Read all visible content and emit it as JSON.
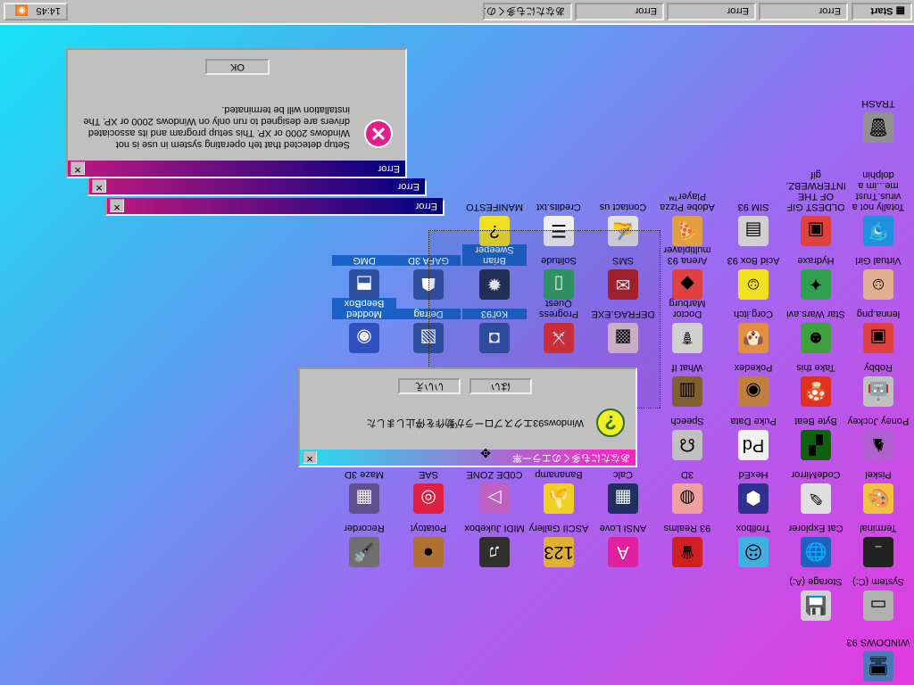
{
  "taskbar": {
    "start_label": "Start",
    "tasks": [
      "Error",
      "Error",
      "Error",
      "あなたにも多くのエ..."
    ],
    "clock": "14:45"
  },
  "desktop_icons": {
    "col1": [
      {
        "label": "WINDOWS 93",
        "icon": "computer-icon",
        "color": "#4a7ab5"
      },
      {
        "label": "System (C:)",
        "icon": "drive-icon",
        "color": "#b0b0b0"
      },
      {
        "label": "Terminal",
        "icon": "terminal-icon",
        "color": "#222222"
      },
      {
        "label": "Piskel",
        "icon": "palette-icon",
        "color": "#f0c040"
      },
      {
        "label": "Poney Jockey",
        "icon": "pony-icon",
        "color": "#b060d0"
      },
      {
        "label": "Robby",
        "icon": "robot-icon",
        "color": "#c0c0c0"
      },
      {
        "label": "lenna.png",
        "icon": "image-icon",
        "color": "#e04040"
      },
      {
        "label": "Virtual Girl",
        "icon": "girl-icon",
        "color": "#e0b090"
      },
      {
        "label": "Totally not a virus.Trust me...im a dolphin",
        "icon": "dolphin-icon",
        "color": "#2090e0"
      },
      {
        "label": "TRASH",
        "icon": "trash-icon",
        "color": "#909090"
      }
    ],
    "col2": [
      {
        "label": "Storage (A:)",
        "icon": "floppy-icon",
        "color": "#d0d0d0"
      },
      {
        "label": "Cat Explorer",
        "icon": "globe-icon",
        "color": "#2060c0"
      },
      {
        "label": "CodeMirror",
        "icon": "codemirror-icon",
        "color": "#e0e0e0"
      },
      {
        "label": "Byte Beat",
        "icon": "bytebeat-icon",
        "color": "#106010"
      },
      {
        "label": "Take this",
        "icon": "mushroom-icon",
        "color": "#e03020"
      },
      {
        "label": "Star Wars.avi",
        "icon": "yoda-icon",
        "color": "#40a040"
      },
      {
        "label": "Hydraxe",
        "icon": "hydra-icon",
        "color": "#30a050"
      },
      {
        "label": "OLDEST GIF OF THE INTERWEBZ.gif",
        "icon": "gif-icon",
        "color": "#e04040"
      }
    ],
    "col3": [
      {
        "label": "Trollbox",
        "icon": "trollbox-icon",
        "color": "#40b0e0"
      },
      {
        "label": "HexEd",
        "icon": "hexed-icon",
        "color": "#303090"
      },
      {
        "label": "Puke Data",
        "icon": "pukedata-icon",
        "color": "#f0f0f0"
      },
      {
        "label": "Pokedex",
        "icon": "pokedex-icon",
        "color": "#c08040"
      },
      {
        "label": "Corg.itch",
        "icon": "corgi-icon",
        "color": "#e09040"
      },
      {
        "label": "Acid Box 93",
        "icon": "smiley-icon",
        "color": "#f0e020"
      },
      {
        "label": "SIM 93",
        "icon": "sim-icon",
        "color": "#d0d0d0"
      }
    ],
    "col4": [
      {
        "label": "93 Realms",
        "icon": "realms-icon",
        "color": "#d02020"
      },
      {
        "label": "3D",
        "icon": "brain-icon",
        "color": "#f0a0a0"
      },
      {
        "label": "Speech",
        "icon": "speech-icon",
        "color": "#c0c0c0"
      },
      {
        "label": "What If",
        "icon": "whatif-icon",
        "color": "#806030"
      },
      {
        "label": "Doctor Marburg",
        "icon": "doctor-icon",
        "color": "#d0d0d0"
      },
      {
        "label": "Arena 93 multiplayer",
        "icon": "arena-icon",
        "color": "#e04040"
      },
      {
        "label": "Adobe Pizza Player™",
        "icon": "pizza-icon",
        "color": "#e0a040"
      }
    ],
    "col5": [
      {
        "label": "ANSI Love",
        "icon": "ansi-icon",
        "color": "#e020a0"
      },
      {
        "label": "Calc",
        "icon": "calc-icon",
        "color": "#203060"
      },
      {
        "label": "DEFRAG.EXE",
        "icon": "defragexe-icon",
        "color": "#e0c0d0"
      },
      {
        "label": "SMS",
        "icon": "sms-icon",
        "color": "#b02020"
      },
      {
        "label": "Contact us",
        "icon": "contact-icon",
        "color": "#e0e0e0"
      }
    ],
    "col6": [
      {
        "label": "ASCII Gallery",
        "icon": "ascii-icon",
        "color": "#e0b030"
      },
      {
        "label": "Bananamp",
        "icon": "banana-icon",
        "color": "#f0d020"
      },
      {
        "label": "Progress Quest",
        "icon": "quest-icon",
        "color": "#e03030"
      },
      {
        "label": "Solitude",
        "icon": "solitude-icon",
        "color": "#30a060"
      },
      {
        "label": "Credits.txt",
        "icon": "textfile-icon",
        "color": "#f0f0f0"
      }
    ],
    "col7": [
      {
        "label": "MIDI Jukebox",
        "icon": "midi-icon",
        "color": "#303030"
      },
      {
        "label": "C0DE ZONE",
        "icon": "code-zone-icon",
        "color": "#c060c0"
      },
      {
        "label": "Kol'93",
        "icon": "kol-icon",
        "color": "#3050a0"
      },
      {
        "label": "Brian Sweeper",
        "icon": "bomb-icon",
        "color": "#203050"
      },
      {
        "label": "MANIFESTO",
        "icon": "manifesto-icon",
        "color": "#f0e020"
      }
    ],
    "col8": [
      {
        "label": "Potatoyt",
        "icon": "potato-icon",
        "color": "#b07030"
      },
      {
        "label": "SAE",
        "icon": "ball-icon",
        "color": "#e02040"
      },
      {
        "label": "Defrag",
        "icon": "defrag-icon",
        "color": "#3050a0"
      },
      {
        "label": "GAFA 3D",
        "icon": "gafa-icon",
        "color": "#3050a0"
      }
    ],
    "col9": [
      {
        "label": "Recorder",
        "icon": "mic-icon",
        "color": "#707070"
      },
      {
        "label": "Maze 3D",
        "icon": "maze-icon",
        "color": "#605090"
      },
      {
        "label": "Modded BeepBox",
        "icon": "beepbox-icon",
        "color": "#3050c0"
      },
      {
        "label": "DMG",
        "icon": "dmg-icon",
        "color": "#3050a0"
      }
    ]
  },
  "error_dialogs": [
    {
      "title": "Error",
      "message": "Setup detected that teh operating system in use is not Windows 2000 or XP. This setup program and its associated drivers are designed to run only on Windows 2000 or XP. The installation will be terminated.",
      "ok_label": "OK"
    },
    {
      "title": "Error"
    },
    {
      "title": "Error"
    }
  ],
  "jp_dialog": {
    "title": "あなたにも多くのエラー率",
    "message": "Windows93エクスプローラが動作を停止しました",
    "yes_label": "はい",
    "no_label": "いいえ"
  },
  "colors": {
    "title_gradient": [
      "#000080",
      "#c01880"
    ],
    "jp_title_gradient": [
      "#ff20c0",
      "#20e0f0"
    ],
    "desktop_gradient": [
      "#14e6f5",
      "#e43ae0"
    ]
  }
}
